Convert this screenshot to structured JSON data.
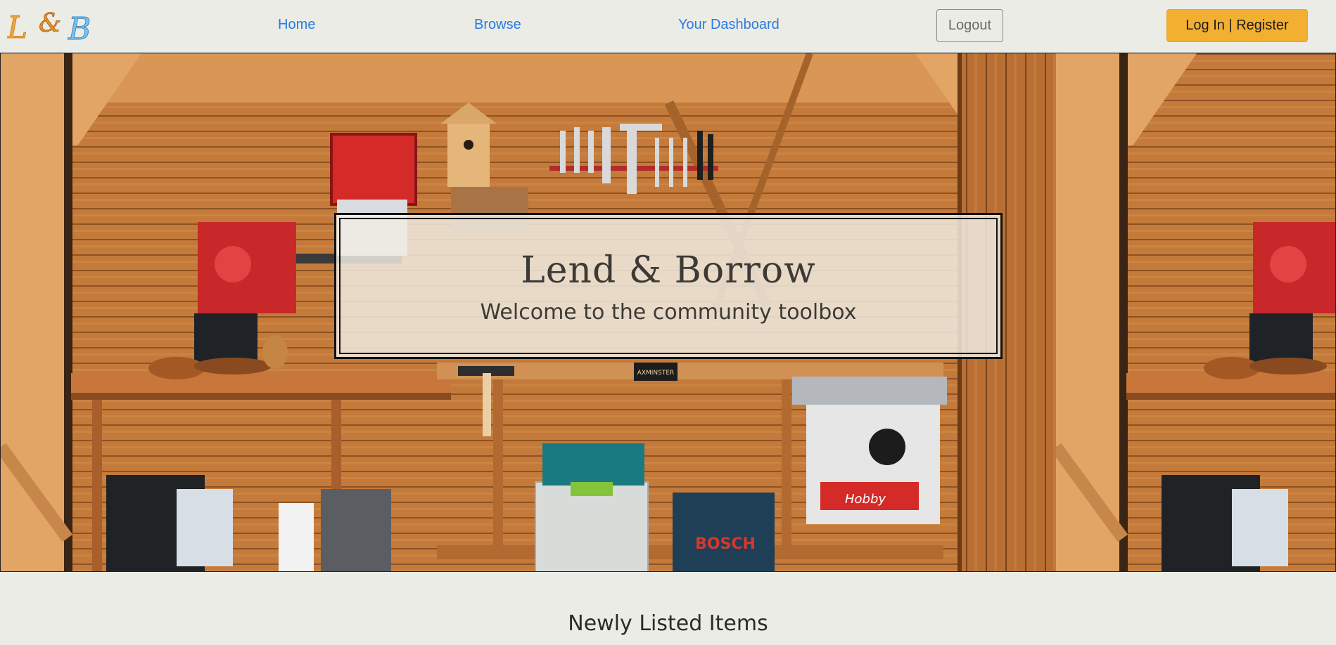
{
  "navbar": {
    "logo_text": "L&B",
    "links": [
      {
        "label": "Home"
      },
      {
        "label": "Browse"
      },
      {
        "label": "Your Dashboard"
      }
    ],
    "logout_label": "Logout",
    "login_label": "Log In | Register"
  },
  "hero": {
    "title": "Lend & Borrow",
    "subtitle": "Welcome to the community toolbox",
    "image_depicts": "wooden workshop shed interior with tools",
    "image_labels": {
      "brand_box": "BOSCH",
      "saw_label": "Hobby",
      "workbench_sign": "AXMINSTER"
    }
  },
  "section": {
    "title": "Newly Listed Items"
  },
  "colors": {
    "background": "#ebece6",
    "link": "#2a7be0",
    "login_button": "#f3af2f",
    "logo_orange": "#f0a43a",
    "logo_blue": "#4aa3df"
  }
}
